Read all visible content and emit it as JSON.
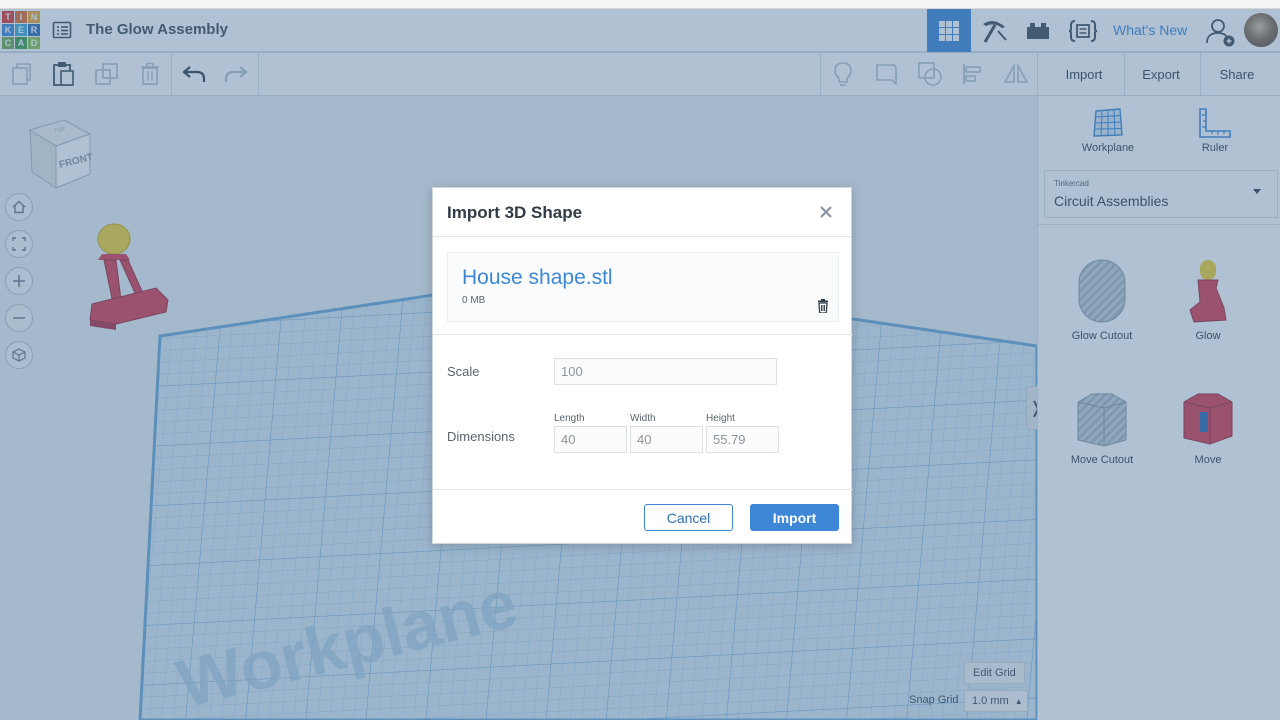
{
  "app": {
    "design_title": "The Glow Assembly",
    "logo_letters": [
      "T",
      "I",
      "N",
      "K",
      "E",
      "R",
      "C",
      "A",
      "D"
    ],
    "logo_colors": [
      "#e0312f",
      "#e66a2c",
      "#f0a52b",
      "#3d87d6",
      "#41a8d8",
      "#2c68b1",
      "#6fa84b",
      "#3a9a46",
      "#8dc34b"
    ],
    "accent_color": "#3d87d6"
  },
  "header": {
    "whats_new": "What's New",
    "icons": [
      "menu-icon",
      "grid-view-icon",
      "pickaxe-icon",
      "bricks-icon",
      "code-blocks-icon",
      "add-user-icon",
      "avatar"
    ]
  },
  "toolbar": {
    "import_label": "Import",
    "export_label": "Export",
    "share_label": "Share",
    "icons": [
      "copy-icon",
      "paste-icon",
      "duplicate-icon",
      "delete-icon",
      "undo-icon",
      "redo-icon",
      "bulb-icon",
      "speech-bubble-icon",
      "group-icon",
      "align-icon",
      "mirror-icon"
    ]
  },
  "viewport": {
    "viewcube_front": "FRONT",
    "viewcube_top": "TOP",
    "workplane_text": "Workplane",
    "edit_grid": "Edit Grid",
    "snap_grid_label": "Snap Grid",
    "snap_grid_value": "1.0 mm"
  },
  "right_panel": {
    "workplane_label": "Workplane",
    "ruler_label": "Ruler",
    "library_caption": "Tinkercad",
    "library_name": "Circuit Assemblies",
    "shapes": [
      {
        "name": "Glow Cutout"
      },
      {
        "name": "Glow"
      },
      {
        "name": "Move Cutout"
      },
      {
        "name": "Move"
      }
    ]
  },
  "modal": {
    "title": "Import 3D Shape",
    "file_name": "House shape.stl",
    "file_size": "0 MB",
    "scale_label": "Scale",
    "scale_value": "100",
    "dimensions_label": "Dimensions",
    "length_label": "Length",
    "width_label": "Width",
    "height_label": "Height",
    "length_value": "40",
    "width_value": "40",
    "height_value": "55.79",
    "cancel_label": "Cancel",
    "import_label": "Import"
  }
}
